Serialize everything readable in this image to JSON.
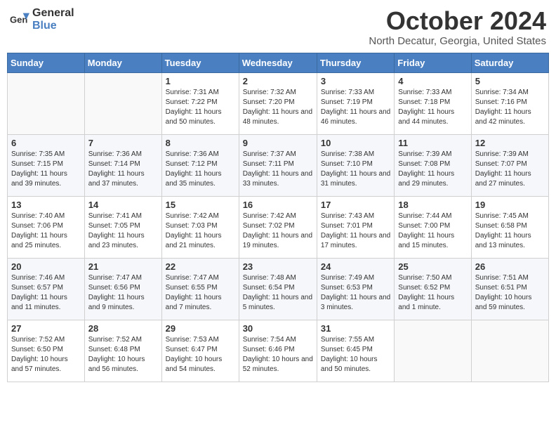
{
  "header": {
    "logo_line1": "General",
    "logo_line2": "Blue",
    "month": "October 2024",
    "location": "North Decatur, Georgia, United States"
  },
  "weekdays": [
    "Sunday",
    "Monday",
    "Tuesday",
    "Wednesday",
    "Thursday",
    "Friday",
    "Saturday"
  ],
  "weeks": [
    [
      {
        "day": "",
        "info": ""
      },
      {
        "day": "",
        "info": ""
      },
      {
        "day": "1",
        "info": "Sunrise: 7:31 AM\nSunset: 7:22 PM\nDaylight: 11 hours and 50 minutes."
      },
      {
        "day": "2",
        "info": "Sunrise: 7:32 AM\nSunset: 7:20 PM\nDaylight: 11 hours and 48 minutes."
      },
      {
        "day": "3",
        "info": "Sunrise: 7:33 AM\nSunset: 7:19 PM\nDaylight: 11 hours and 46 minutes."
      },
      {
        "day": "4",
        "info": "Sunrise: 7:33 AM\nSunset: 7:18 PM\nDaylight: 11 hours and 44 minutes."
      },
      {
        "day": "5",
        "info": "Sunrise: 7:34 AM\nSunset: 7:16 PM\nDaylight: 11 hours and 42 minutes."
      }
    ],
    [
      {
        "day": "6",
        "info": "Sunrise: 7:35 AM\nSunset: 7:15 PM\nDaylight: 11 hours and 39 minutes."
      },
      {
        "day": "7",
        "info": "Sunrise: 7:36 AM\nSunset: 7:14 PM\nDaylight: 11 hours and 37 minutes."
      },
      {
        "day": "8",
        "info": "Sunrise: 7:36 AM\nSunset: 7:12 PM\nDaylight: 11 hours and 35 minutes."
      },
      {
        "day": "9",
        "info": "Sunrise: 7:37 AM\nSunset: 7:11 PM\nDaylight: 11 hours and 33 minutes."
      },
      {
        "day": "10",
        "info": "Sunrise: 7:38 AM\nSunset: 7:10 PM\nDaylight: 11 hours and 31 minutes."
      },
      {
        "day": "11",
        "info": "Sunrise: 7:39 AM\nSunset: 7:08 PM\nDaylight: 11 hours and 29 minutes."
      },
      {
        "day": "12",
        "info": "Sunrise: 7:39 AM\nSunset: 7:07 PM\nDaylight: 11 hours and 27 minutes."
      }
    ],
    [
      {
        "day": "13",
        "info": "Sunrise: 7:40 AM\nSunset: 7:06 PM\nDaylight: 11 hours and 25 minutes."
      },
      {
        "day": "14",
        "info": "Sunrise: 7:41 AM\nSunset: 7:05 PM\nDaylight: 11 hours and 23 minutes."
      },
      {
        "day": "15",
        "info": "Sunrise: 7:42 AM\nSunset: 7:03 PM\nDaylight: 11 hours and 21 minutes."
      },
      {
        "day": "16",
        "info": "Sunrise: 7:42 AM\nSunset: 7:02 PM\nDaylight: 11 hours and 19 minutes."
      },
      {
        "day": "17",
        "info": "Sunrise: 7:43 AM\nSunset: 7:01 PM\nDaylight: 11 hours and 17 minutes."
      },
      {
        "day": "18",
        "info": "Sunrise: 7:44 AM\nSunset: 7:00 PM\nDaylight: 11 hours and 15 minutes."
      },
      {
        "day": "19",
        "info": "Sunrise: 7:45 AM\nSunset: 6:58 PM\nDaylight: 11 hours and 13 minutes."
      }
    ],
    [
      {
        "day": "20",
        "info": "Sunrise: 7:46 AM\nSunset: 6:57 PM\nDaylight: 11 hours and 11 minutes."
      },
      {
        "day": "21",
        "info": "Sunrise: 7:47 AM\nSunset: 6:56 PM\nDaylight: 11 hours and 9 minutes."
      },
      {
        "day": "22",
        "info": "Sunrise: 7:47 AM\nSunset: 6:55 PM\nDaylight: 11 hours and 7 minutes."
      },
      {
        "day": "23",
        "info": "Sunrise: 7:48 AM\nSunset: 6:54 PM\nDaylight: 11 hours and 5 minutes."
      },
      {
        "day": "24",
        "info": "Sunrise: 7:49 AM\nSunset: 6:53 PM\nDaylight: 11 hours and 3 minutes."
      },
      {
        "day": "25",
        "info": "Sunrise: 7:50 AM\nSunset: 6:52 PM\nDaylight: 11 hours and 1 minute."
      },
      {
        "day": "26",
        "info": "Sunrise: 7:51 AM\nSunset: 6:51 PM\nDaylight: 10 hours and 59 minutes."
      }
    ],
    [
      {
        "day": "27",
        "info": "Sunrise: 7:52 AM\nSunset: 6:50 PM\nDaylight: 10 hours and 57 minutes."
      },
      {
        "day": "28",
        "info": "Sunrise: 7:52 AM\nSunset: 6:48 PM\nDaylight: 10 hours and 56 minutes."
      },
      {
        "day": "29",
        "info": "Sunrise: 7:53 AM\nSunset: 6:47 PM\nDaylight: 10 hours and 54 minutes."
      },
      {
        "day": "30",
        "info": "Sunrise: 7:54 AM\nSunset: 6:46 PM\nDaylight: 10 hours and 52 minutes."
      },
      {
        "day": "31",
        "info": "Sunrise: 7:55 AM\nSunset: 6:45 PM\nDaylight: 10 hours and 50 minutes."
      },
      {
        "day": "",
        "info": ""
      },
      {
        "day": "",
        "info": ""
      }
    ]
  ]
}
